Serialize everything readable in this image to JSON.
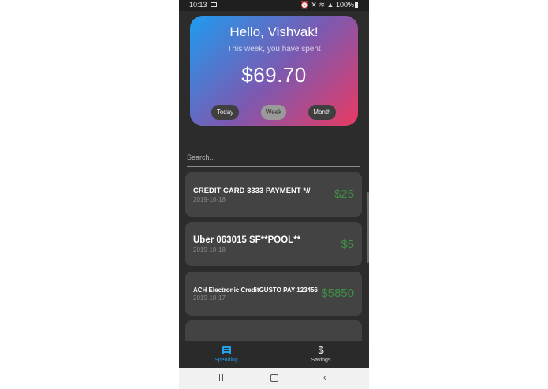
{
  "status_bar": {
    "time": "10:13",
    "battery": "100%"
  },
  "summary": {
    "greeting": "Hello, Vishvak!",
    "subtitle": "This week, you have spent",
    "amount": "$69.70",
    "filters": [
      "Today",
      "Week",
      "Month"
    ],
    "active_filter": "Week"
  },
  "search": {
    "placeholder": "Search..."
  },
  "transactions": [
    {
      "title": "CREDIT CARD 3333 PAYMENT *//",
      "date": "2019-10-18",
      "amount": "$25"
    },
    {
      "title": "Uber 063015 SF**POOL**",
      "date": "2019-10-18",
      "amount": "$5"
    },
    {
      "title": "ACH Electronic CreditGUSTO PAY 123456",
      "date": "2019-10-17",
      "amount": "$5850"
    }
  ],
  "bottom_nav": {
    "items": [
      {
        "label": "Spending",
        "icon": "list-icon",
        "active": true
      },
      {
        "label": "Savings",
        "icon": "dollar-icon",
        "active": false
      }
    ]
  },
  "colors": {
    "background": "#2c2c2c",
    "card": "#434343",
    "amount_green": "#3f8f47",
    "accent_blue": "#23a2e8",
    "gradient_start": "#1e9cf0",
    "gradient_end": "#e93a63"
  }
}
